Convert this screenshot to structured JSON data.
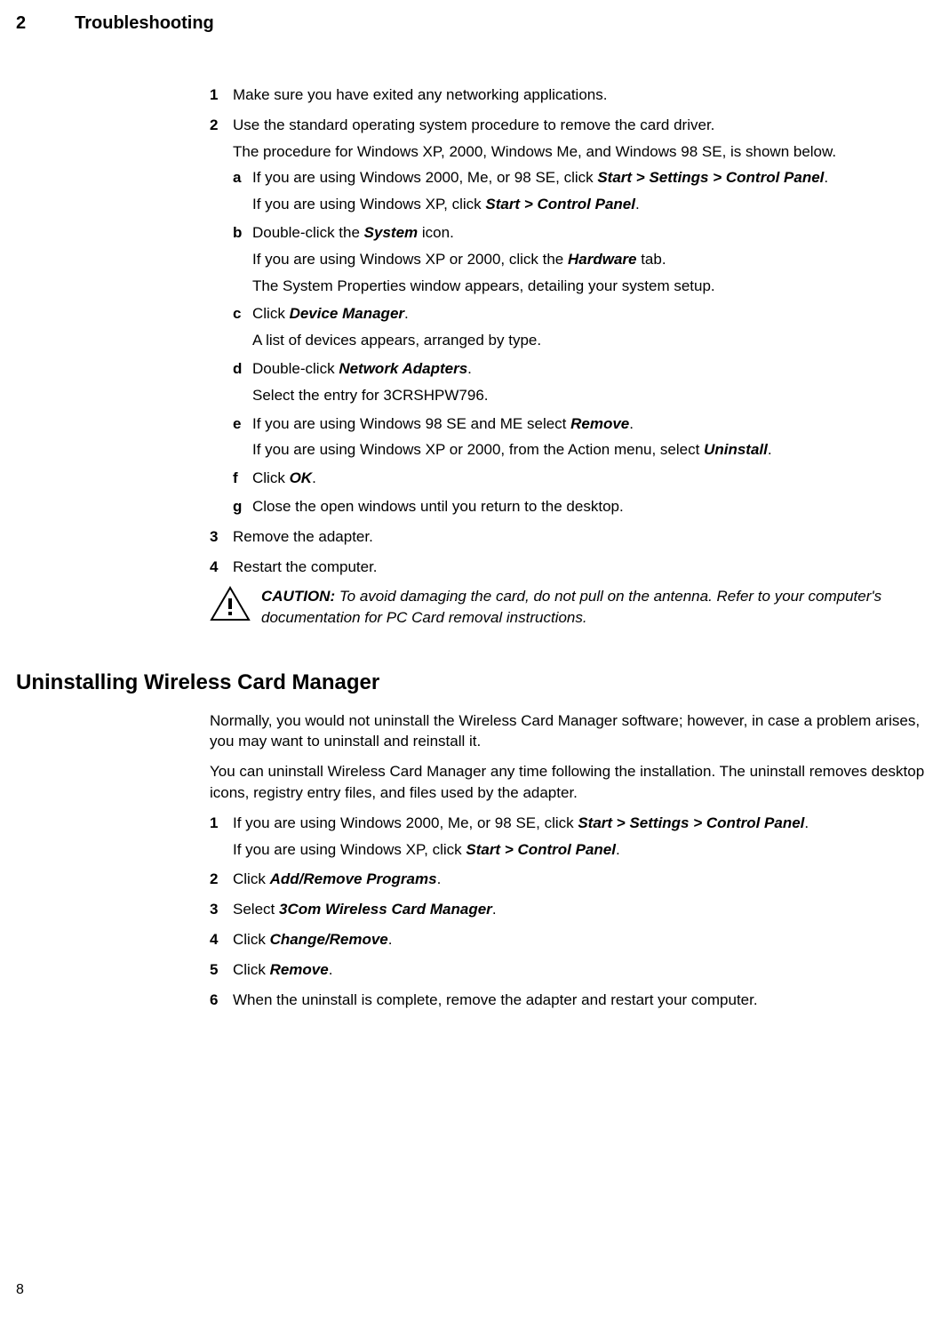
{
  "header": {
    "chapter_num": "2",
    "chapter_title": "Troubleshooting"
  },
  "steps": {
    "s1": "Make sure you have exited any networking applications.",
    "s2_line1": "Use the standard operating system procedure to remove the card driver.",
    "s2_line2": "The procedure for Windows XP, 2000, Windows Me, and Windows 98 SE, is shown below.",
    "a": {
      "pre": "If you are using Windows 2000, Me, or 98 SE, click ",
      "em1": "Start > Settings > Control Panel",
      "post1": ".",
      "line2_pre": "If you are using Windows XP, click ",
      "line2_em": "Start > Control Panel",
      "line2_post": "."
    },
    "b": {
      "line1_pre": "Double-click the ",
      "line1_em": "System",
      "line1_post": " icon.",
      "line2_pre": "If you are using Windows XP or 2000, click the ",
      "line2_em": "Hardware",
      "line2_post": " tab.",
      "line3": "The System Properties window appears, detailing your system setup."
    },
    "c": {
      "line1_pre": "Click ",
      "line1_em": "Device Manager",
      "line1_post": ".",
      "line2": "A list of devices appears, arranged by type."
    },
    "d": {
      "line1_pre": "Double-click ",
      "line1_em": "Network Adapters",
      "line1_post": ".",
      "line2": "Select the entry for 3CRSHPW796."
    },
    "e": {
      "line1_pre": "If you are using Windows 98 SE and ME select ",
      "line1_em": "Remove",
      "line1_post": ".",
      "line2_pre": "If you are using Windows XP or 2000, from the Action menu, select ",
      "line2_em": "Uninstall",
      "line2_post": "."
    },
    "f": {
      "pre": "Click ",
      "em": "OK",
      "post": "."
    },
    "g": "Close the open windows until you return to the desktop.",
    "s3": "Remove the adapter.",
    "s4": "Restart the computer."
  },
  "caution": {
    "label": "CAUTION:",
    "text": " To avoid damaging the card, do not pull on the antenna. Refer to your computer's documentation for PC Card removal instructions."
  },
  "section2": {
    "heading": "Uninstalling Wireless Card Manager",
    "intro1": "Normally, you would not uninstall the Wireless Card Manager software; however, in case a problem arises, you may want to uninstall and reinstall it.",
    "intro2": "You can uninstall Wireless Card Manager any time following the installation. The uninstall removes desktop icons, registry entry files, and files used by the adapter.",
    "steps": {
      "s1": {
        "line1_pre": "If you are using Windows 2000, Me, or 98 SE, click ",
        "line1_em": "Start > Settings > Control Panel",
        "line1_post": ".",
        "line2_pre": "If you are using Windows XP, click ",
        "line2_em": "Start > Control Panel",
        "line2_post": "."
      },
      "s2": {
        "pre": "Click ",
        "em": "Add/Remove Programs",
        "post": "."
      },
      "s3": {
        "pre": "Select ",
        "em": "3Com Wireless Card Manager",
        "post": "."
      },
      "s4": {
        "pre": "Click ",
        "em": "Change/Remove",
        "post": "."
      },
      "s5": {
        "pre": "Click ",
        "em": "Remove",
        "post": "."
      },
      "s6": "When the uninstall is complete, remove the adapter and restart your computer."
    }
  },
  "page_num": "8"
}
